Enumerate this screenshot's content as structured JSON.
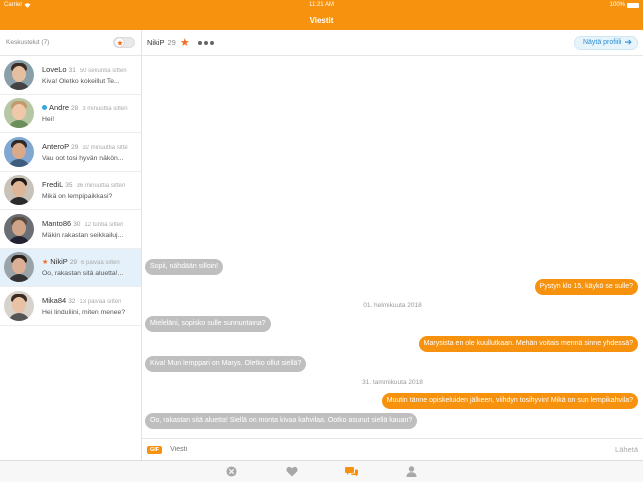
{
  "status": {
    "carrier": "Carrier",
    "time": "11:21 AM",
    "battery": "100%"
  },
  "nav": {
    "title": "Viestit"
  },
  "sidebar": {
    "title": "Keskustelut (7)",
    "conversations": [
      {
        "name": "LoveLo",
        "age": "31",
        "time": "50 sekuntia sitten",
        "message": "Kiva! Oletko kokeillut Te..."
      },
      {
        "name": "Andre",
        "age": "28",
        "time": "3 minuuttia sitten",
        "message": "Hei!"
      },
      {
        "name": "AnteroP",
        "age": "29",
        "time": "32 minuuttia sitte",
        "message": "Vau oot tosi hyvän näkön..."
      },
      {
        "name": "FrediL",
        "age": "35",
        "time": "36 minuuttia sitten",
        "message": "Mikä on lempipaikkasi?"
      },
      {
        "name": "Manto86",
        "age": "30",
        "time": "12 tuntia sitten",
        "message": "Mäkin rakastan seikkailuj..."
      },
      {
        "name": "NikiP",
        "age": "29",
        "time": "6 päivää sitten",
        "message": "Oo, rakastan sitä aluetta!..."
      },
      {
        "name": "Mika84",
        "age": "32",
        "time": "13 päivää sitten",
        "message": "Hei linduliini, miten menee?"
      }
    ]
  },
  "chat": {
    "name": "NikiP",
    "age": "29",
    "profile_button": "Näytä profiili",
    "messages": [
      {
        "text": "Sopii, nähdään silloin!"
      },
      {
        "text": "Pystyn klo 15, käykö se sulle?"
      },
      {
        "text": "01. helmikuuta 2018"
      },
      {
        "text": "Mieleläni, sopisko sulle sunnuntaina?"
      },
      {
        "text": "Marysista en ole kuullutkaan. Mehän voitais mennä sinne yhdessä?"
      },
      {
        "text": "Kiva! Mun lemppari on Marys. Oletko ollut siellä?"
      },
      {
        "text": "31. tammikuuta 2018"
      },
      {
        "text": "Muutin tänne opiskeluiden jälkeen, viihdyn tosihyvin! Mikä on sun lempikahvila?"
      },
      {
        "text": "Oo, rakastan sitä aluetta! Siellä on monta kivaa kahvilaa. Ootko asunut siellä kauan?"
      }
    ],
    "compose": {
      "gif": "GIF",
      "placeholder": "Viesti",
      "send": "Lähetä"
    }
  },
  "colors": {
    "accent": "#f7920f",
    "star": "#f36c1e",
    "incoming": "#bfbfbf",
    "link": "#2a8fd0"
  },
  "tabs": [
    {
      "icon": "close-circle-icon"
    },
    {
      "icon": "heart-icon"
    },
    {
      "icon": "chat-bubbles-icon"
    },
    {
      "icon": "person-icon"
    }
  ]
}
